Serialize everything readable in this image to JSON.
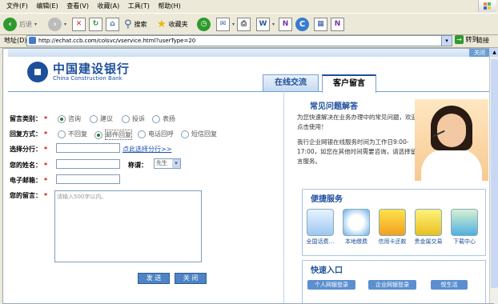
{
  "browser": {
    "menu": [
      "文件(F)",
      "编辑(E)",
      "查看(V)",
      "收藏(A)",
      "工具(T)",
      "帮助(H)"
    ],
    "toolbar": {
      "back_label": "后退",
      "search_label": "搜索",
      "favorites_label": "收藏夹"
    },
    "address_label": "地址(D)",
    "url": "http://echat.ccb.com/colsvc/vservice.html?userType=20",
    "go_label": "转到",
    "links_label": "链接"
  },
  "page": {
    "close_label": "关闭",
    "logo": {
      "cn": "中国建设银行",
      "en": "China Construction Bank"
    },
    "tabs": [
      "在线交流",
      "客户留言"
    ],
    "form": {
      "category_label": "留言类别：",
      "category_options": [
        "咨询",
        "建议",
        "投诉",
        "表扬"
      ],
      "reply_label": "回复方式：",
      "reply_options": [
        "不回复",
        "邮件回复",
        "电话回呼",
        "短信回复"
      ],
      "branch_label": "选择分行：",
      "branch_link": "点此选择分行>>",
      "name_label": "您的姓名：",
      "title_label": "称谓：",
      "title_value": "先生",
      "email_label": "电子邮箱：",
      "message_label": "您的留言：",
      "message_placeholder": "请输入500字以内。",
      "submit_label": "发 送",
      "close_label": "关 闭"
    },
    "faq": {
      "title": "常见问题解答",
      "p1": "为您快速解决在业务办理中的常见问题，欢迎点击使用！",
      "p2": "我行企业网银在线服务时间为工作日9:00-17:00，如您在其他时间需要咨询，请选择留言服务。"
    },
    "services": {
      "title": "便捷服务",
      "items": [
        "全国话费…",
        "本地缴费",
        "信用卡还款",
        "贵金属交易",
        "下载中心"
      ]
    },
    "quick": {
      "title": "快速入口",
      "items": [
        "个人网银登录",
        "企业网银登录",
        "悦生活"
      ]
    }
  }
}
